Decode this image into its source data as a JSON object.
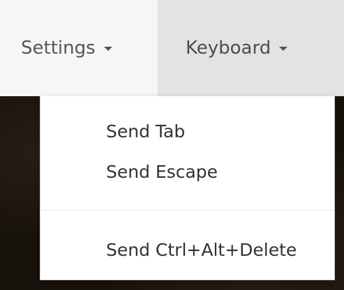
{
  "navbar": {
    "items": [
      {
        "label": "Settings",
        "icon": "caret-down-icon"
      },
      {
        "label": "Keyboard",
        "icon": "caret-down-icon",
        "active": true
      }
    ]
  },
  "keyboard_menu": {
    "items": [
      {
        "label": "Send Tab"
      },
      {
        "label": "Send Escape"
      },
      {
        "label": "Send Ctrl+Alt+Delete"
      }
    ]
  },
  "colors": {
    "navbar_bg": "#f6f6f6",
    "active_nav_bg": "#e3e3e3",
    "menu_text": "#333333",
    "nav_text": "#555555"
  }
}
